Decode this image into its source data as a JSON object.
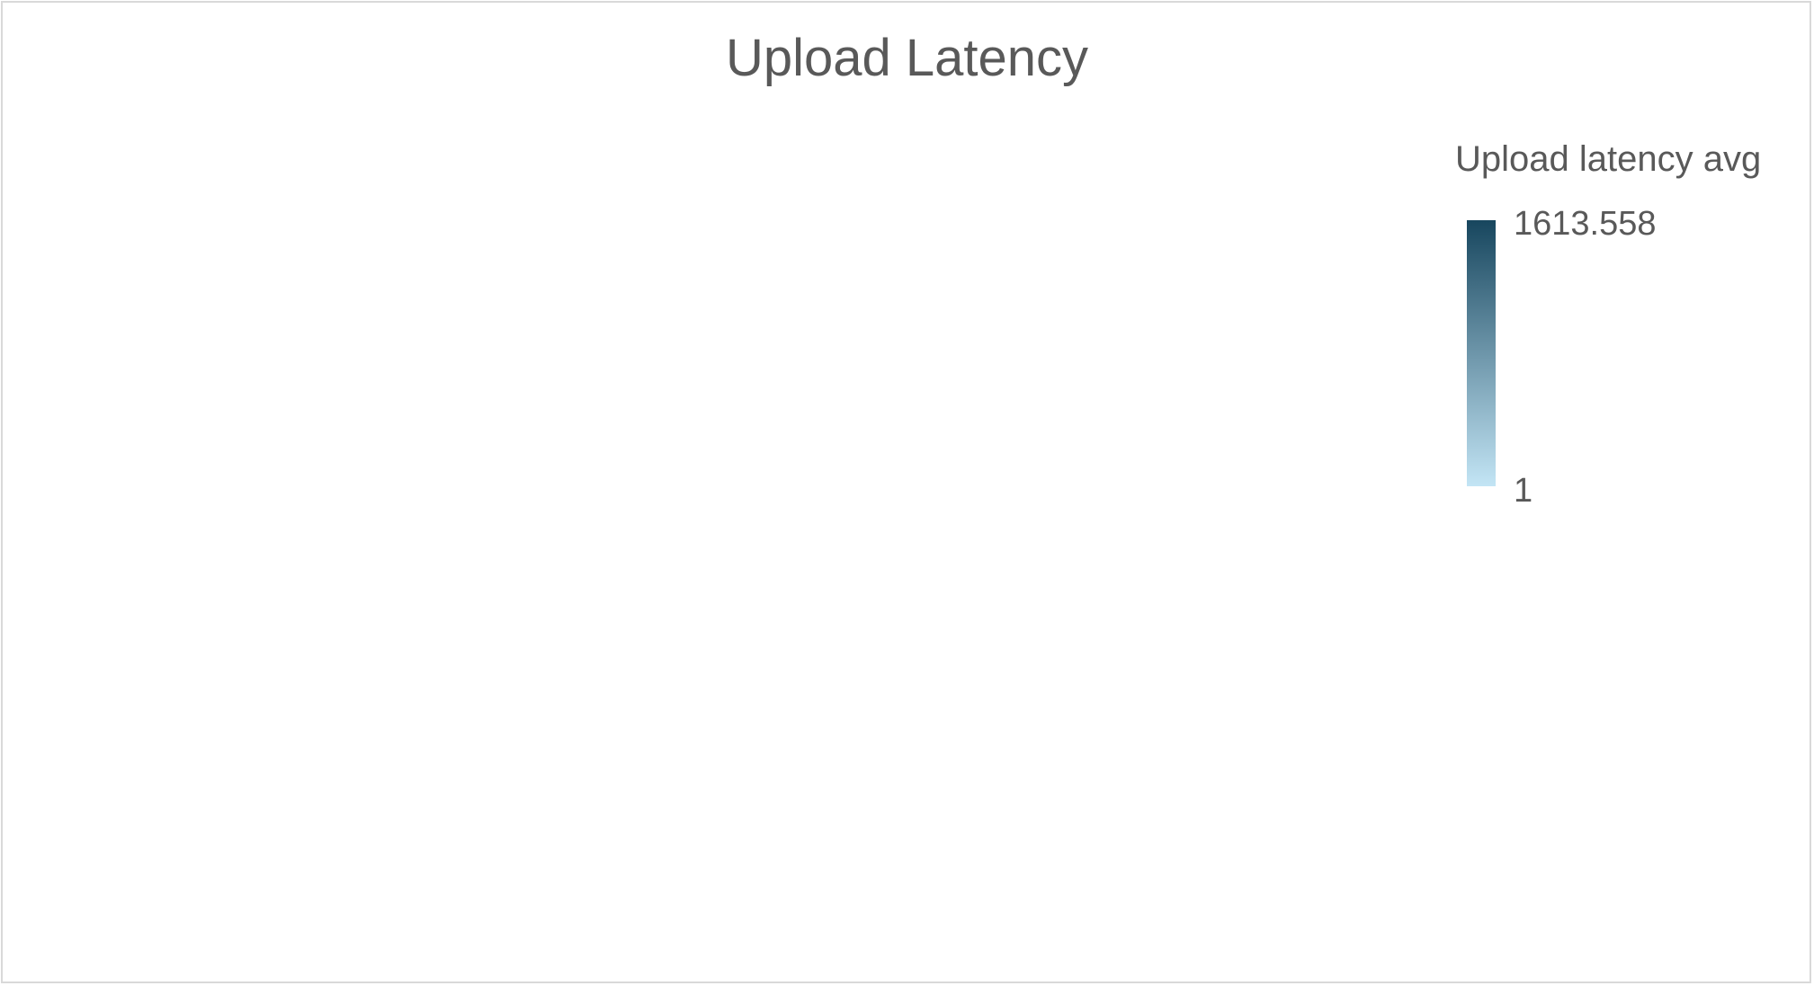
{
  "chart_data": {
    "type": "heatmap",
    "title": "Upload Latency",
    "values": [],
    "legend": {
      "title": "Upload latency avg",
      "max_label": "1613.558",
      "min_label": "1",
      "max": 1613.558,
      "min": 1,
      "color_max": "#17465e",
      "color_min": "#c3e5f5",
      "placement": "right"
    }
  }
}
